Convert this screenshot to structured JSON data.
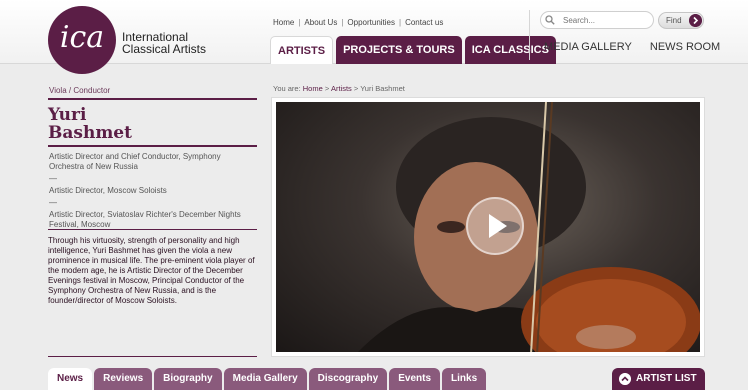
{
  "logo": {
    "mark": "ica",
    "line1": "International",
    "line2": "Classical Artists"
  },
  "util_links": [
    "Home",
    "About Us",
    "Opportunities",
    "Contact us"
  ],
  "main_tabs": [
    {
      "label": "ARTISTS",
      "active": true
    },
    {
      "label": "PROJECTS & TOURS",
      "active": false
    },
    {
      "label": "ICA CLASSICS",
      "active": false
    }
  ],
  "right_links": [
    "MEDIA GALLERY",
    "NEWS ROOM"
  ],
  "search": {
    "placeholder": "Search...",
    "button": "Find"
  },
  "artist": {
    "category": "Viola / Conductor",
    "name_first": "Yuri",
    "name_last": "Bashmet",
    "positions": [
      "Artistic Director and Chief Conductor, Symphony Orchestra of New Russia",
      "Artistic Director, Moscow Soloists",
      "Artistic Director, Sviatoslav Richter's December Nights Festival, Moscow"
    ],
    "separator": "—",
    "bio": "Through his virtuosity, strength of personality and high intelligence, Yuri Bashmet has given the viola a new prominence in musical life. The pre-eminent viola player of the modern age, he is Artistic Director of the December Evenings festival in Moscow, Principal Conductor of the Symphony Orchestra of New Russia, and is the founder/director of Moscow Soloists."
  },
  "breadcrumb": {
    "prefix": "You are:",
    "items": [
      "Home",
      "Artists",
      "Yuri Bashmet"
    ],
    "separator": ">"
  },
  "sub_tabs": [
    {
      "label": "News",
      "active": true
    },
    {
      "label": "Reviews",
      "active": false
    },
    {
      "label": "Biography",
      "active": false
    },
    {
      "label": "Media Gallery",
      "active": false
    },
    {
      "label": "Discography",
      "active": false
    },
    {
      "label": "Events",
      "active": false
    },
    {
      "label": "Links",
      "active": false
    }
  ],
  "artist_list_button": "ARTIST LIST",
  "colors": {
    "brand": "#5b1e46",
    "tab_inactive": "#8a5a7c",
    "background": "#ececec"
  }
}
